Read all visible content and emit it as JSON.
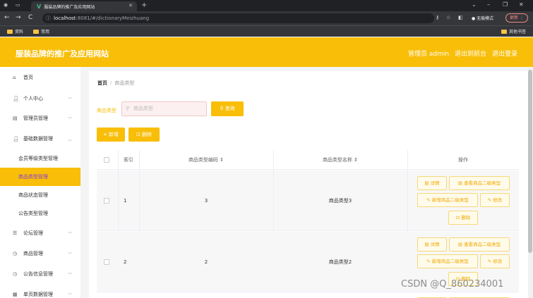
{
  "browser": {
    "tab_title": "服装品牌的推广及应用网站",
    "url_host": "localhost",
    "url_path": ":8081/#/dictionaryMeizhuang",
    "incognito_label": "无痕模式",
    "update_label": "更新",
    "bookmarks": [
      "资料",
      "常用"
    ],
    "other_bookmarks": "其他书签"
  },
  "header": {
    "title": "服装品牌的推广及应用网站",
    "admin_label": "管理员 admin",
    "back_label": "退出到前台",
    "logout_label": "退出登录"
  },
  "sidebar": {
    "items": [
      {
        "label": "首页",
        "icon": "home-icon"
      },
      {
        "label": "个人中心",
        "icon": "user-icon"
      },
      {
        "label": "管理员管理",
        "icon": "admin-icon"
      },
      {
        "label": "基础数据管理",
        "icon": "user-icon"
      },
      {
        "label": "论坛管理",
        "icon": "forum-icon"
      },
      {
        "label": "商品管理",
        "icon": "product-icon"
      },
      {
        "label": "公告信息管理",
        "icon": "notice-icon"
      },
      {
        "label": "单页数据管理",
        "icon": "page-icon"
      }
    ],
    "subitems": [
      "会员等级类型管理",
      "商品类型管理",
      "商品状态管理",
      "公告类型管理"
    ]
  },
  "breadcrumb": {
    "home": "首页",
    "current": "商品类型"
  },
  "search": {
    "label": "商品类型",
    "placeholder": "商品类型",
    "button": "查询"
  },
  "actions": {
    "add": "新增",
    "delete": "删除"
  },
  "table": {
    "headers": {
      "index": "索引",
      "code": "商品类型编码",
      "name": "商品类型名称",
      "ops": "操作"
    },
    "rows": [
      {
        "index": "1",
        "code": "3",
        "name": "商品类型3"
      },
      {
        "index": "2",
        "code": "2",
        "name": "商品类型2"
      }
    ],
    "ops": {
      "detail": "详情",
      "view_sub": "查看商品二级类型",
      "add_sub": "新增商品二级类型",
      "edit": "修改",
      "delete": "删除"
    }
  },
  "watermark": "CSDN @Q_860234001",
  "colors": {
    "accent": "#f8be08",
    "active_text": "#8b3bd6"
  }
}
